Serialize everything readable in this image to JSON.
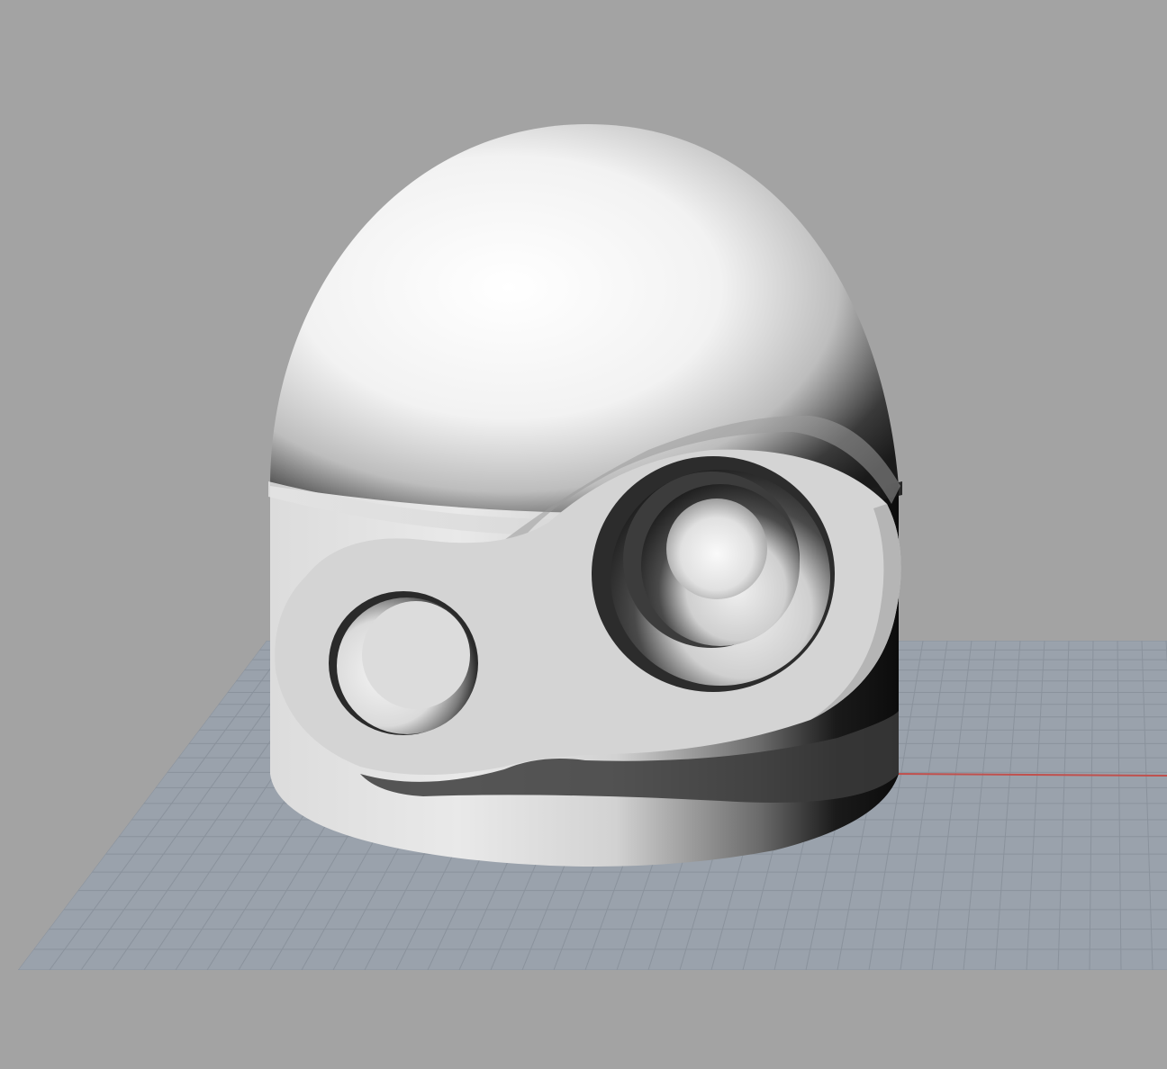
{
  "viewport": {
    "background": "#a3a3a3",
    "grid_color": "#8a929c",
    "grid_fill": "#9aa2ac",
    "x_axis_color": "#c0504d",
    "model_color": "#e6e6e6",
    "shadow_color": "#111111"
  },
  "scene": {
    "object": "robot-head",
    "view": "perspective",
    "eyes": 2
  }
}
